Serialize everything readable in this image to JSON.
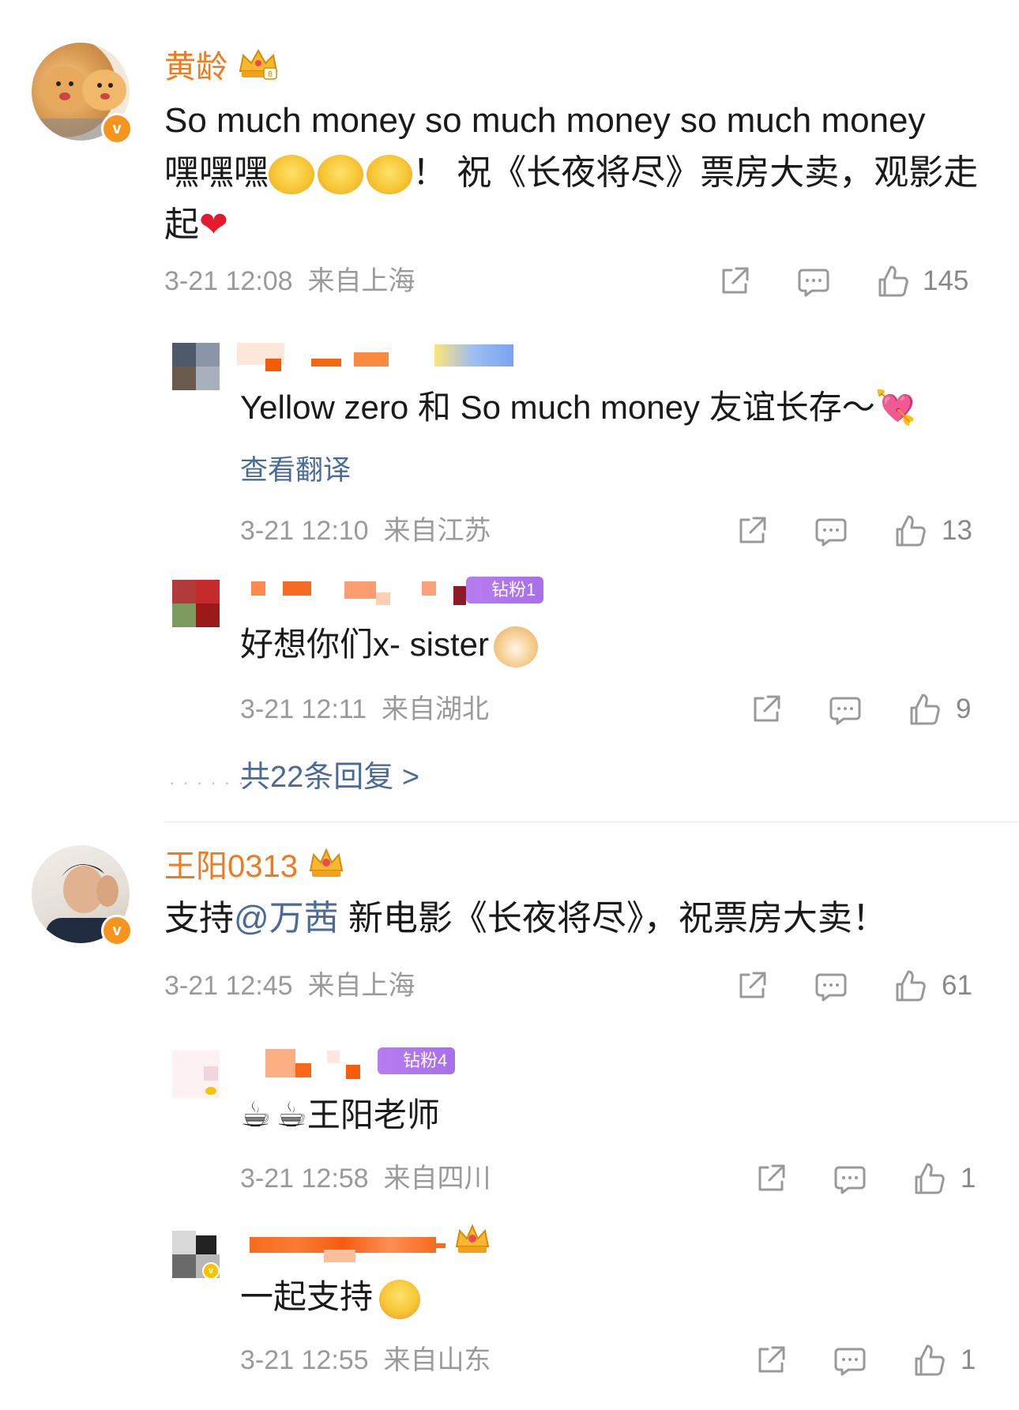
{
  "comments": [
    {
      "username": "黄龄",
      "text_line1": "So much money so much money so much money",
      "text_line2_prefix": "嘿嘿嘿",
      "text_line2_suffix": "！ 祝《长夜将尽》票房大卖，观影走",
      "text_line3": "起",
      "time": "3-21 12:08",
      "location": "来自上海",
      "likes": "145",
      "replies": [
        {
          "text": "Yellow zero 和 So much money 友谊长存～",
          "translate": "查看翻译",
          "time": "3-21 12:10",
          "location": "来自江苏",
          "likes": "13"
        },
        {
          "badge": "钻粉1",
          "text": "好想你们x- sister",
          "time": "3-21 12:11",
          "location": "来自湖北",
          "likes": "9"
        }
      ],
      "more_replies": "共22条回复 >"
    },
    {
      "username": "王阳0313",
      "text_prefix": "支持",
      "mention": "@万茜",
      "text_suffix": " 新电影《长夜将尽》，祝票房大卖！",
      "time": "3-21 12:45",
      "location": "来自上海",
      "likes": "61",
      "replies": [
        {
          "badge": "钻粉4",
          "text": "王阳老师",
          "time": "3-21 12:58",
          "location": "来自四川",
          "likes": "1"
        },
        {
          "text": "一起支持",
          "time": "3-21 12:55",
          "location": "来自山东",
          "likes": "1"
        }
      ]
    }
  ],
  "colors": {
    "username": "#f27a1d",
    "link": "#4a6a9b",
    "meta": "#9a9a9a",
    "verified": "#f7941d",
    "badge": "#b77cf0"
  },
  "icons": [
    "share-icon",
    "comment-icon",
    "like-icon",
    "crown-icon",
    "verified-icon"
  ]
}
